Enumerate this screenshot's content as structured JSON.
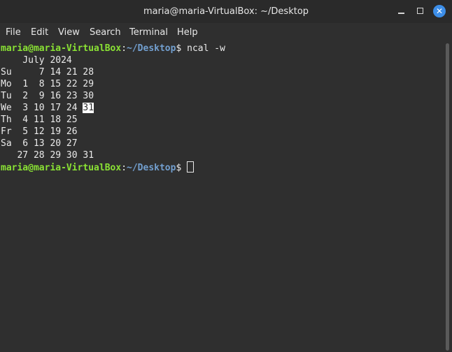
{
  "window": {
    "title": "maria@maria-VirtualBox: ~/Desktop",
    "accent_color": "#3d8ee8"
  },
  "menubar": {
    "items": [
      "File",
      "Edit",
      "View",
      "Search",
      "Terminal",
      "Help"
    ]
  },
  "terminal": {
    "prompt_user": "maria@maria-VirtualBox",
    "prompt_sep": ":",
    "prompt_path": "~/Desktop",
    "prompt_end": "$ ",
    "command": "ncal -w",
    "calendar_header": "    July 2024",
    "rows": [
      {
        "prefix": "Su     7 14 21 ",
        "hl": "",
        "suffix": "28"
      },
      {
        "prefix": "Mo  1  8 15 22 ",
        "hl": "",
        "suffix": "29"
      },
      {
        "prefix": "Tu  2  9 16 23 ",
        "hl": "",
        "suffix": "30"
      },
      {
        "prefix": "We  3 10 17 24 ",
        "hl": "31",
        "suffix": ""
      },
      {
        "prefix": "Th  4 11 18 25",
        "hl": "",
        "suffix": ""
      },
      {
        "prefix": "Fr  5 12 19 26",
        "hl": "",
        "suffix": ""
      },
      {
        "prefix": "Sa  6 13 20 27",
        "hl": "",
        "suffix": ""
      }
    ],
    "week_numbers": "   27 28 29 30 31",
    "colors": {
      "user": "#8ae234",
      "path": "#729fcf",
      "text": "#ebebeb"
    }
  }
}
